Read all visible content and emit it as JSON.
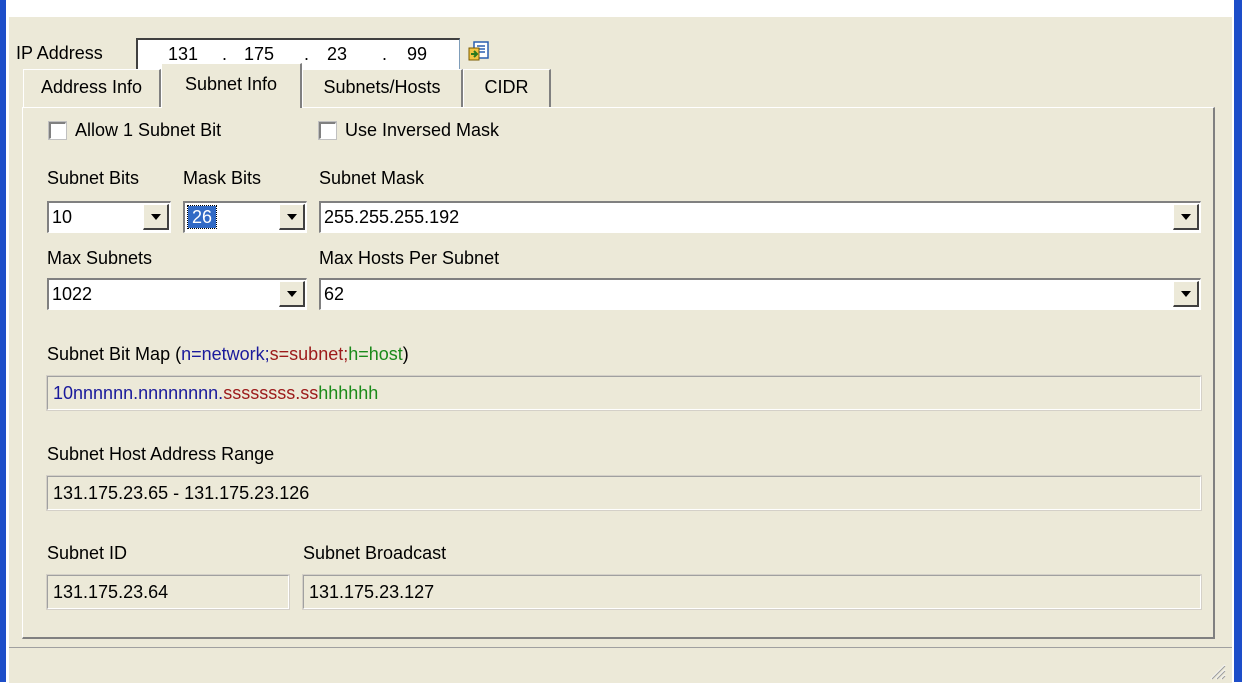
{
  "ip": {
    "label": "IP Address",
    "octets": [
      "131",
      "175",
      "23",
      "99"
    ],
    "separator": "."
  },
  "tabs": [
    {
      "label": "Address Info",
      "active": false
    },
    {
      "label": "Subnet Info",
      "active": true
    },
    {
      "label": "Subnets/Hosts",
      "active": false
    },
    {
      "label": "CIDR",
      "active": false
    }
  ],
  "options": {
    "allow_one_subnet_bit": {
      "label": "Allow 1 Subnet Bit",
      "checked": false
    },
    "use_inversed_mask": {
      "label": "Use Inversed Mask",
      "checked": false
    }
  },
  "fields": {
    "subnet_bits": {
      "label": "Subnet Bits",
      "value": "10"
    },
    "mask_bits": {
      "label": "Mask Bits",
      "value": "26"
    },
    "subnet_mask": {
      "label": "Subnet Mask",
      "value": "255.255.255.192"
    },
    "max_subnets": {
      "label": "Max Subnets",
      "value": "1022"
    },
    "max_hosts": {
      "label": "Max Hosts Per Subnet",
      "value": "62"
    }
  },
  "bitmap": {
    "label_prefix": "Subnet Bit Map (",
    "legend_n": "n=network",
    "sep1": ";",
    "legend_s": "s=subnet",
    "sep2": ";",
    "legend_h": "h=host",
    "label_suffix": ")",
    "network_part": "10nnnnnn.nnnnnnnn.",
    "subnet_part": "ssssssss.ss",
    "host_part": "hhhhhh"
  },
  "range": {
    "label": "Subnet Host Address Range",
    "value": "131.175.23.65 - 131.175.23.126"
  },
  "subnet_id": {
    "label": "Subnet ID",
    "value": "131.175.23.64"
  },
  "broadcast": {
    "label": "Subnet Broadcast",
    "value": "131.175.23.127"
  },
  "colors": {
    "network": "#1a1a9c",
    "subnet": "#9c1a1a",
    "host": "#1a8a1a",
    "selection": "#316ac5",
    "window": "#ece9d8",
    "frame": "#1d4ec9"
  }
}
